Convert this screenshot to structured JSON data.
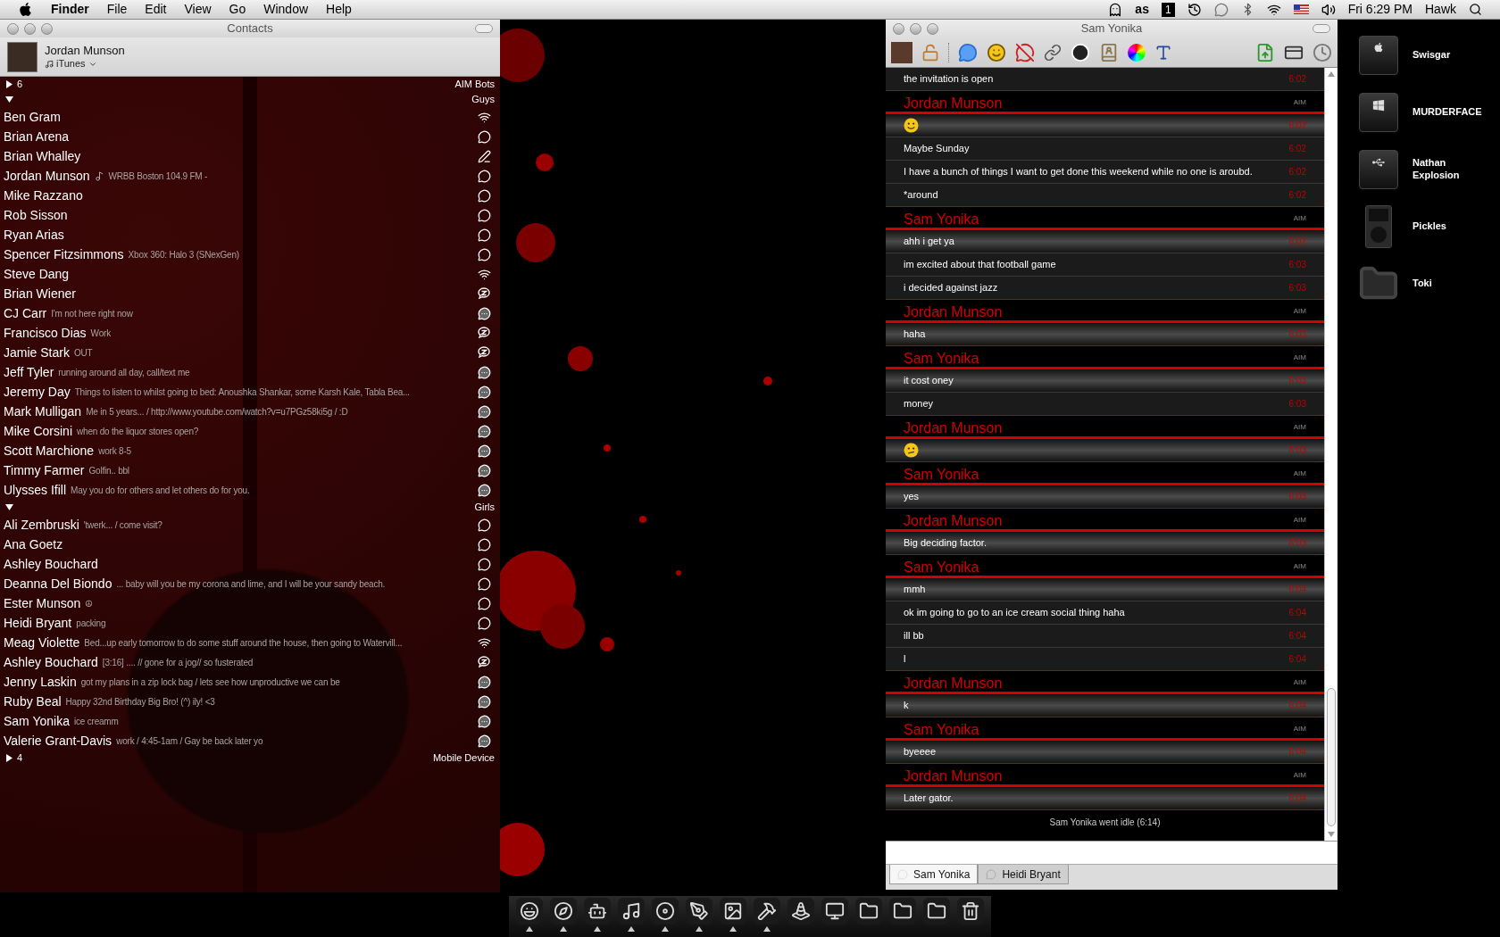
{
  "menu_bar": {
    "app": "Finder",
    "menus": [
      "File",
      "Edit",
      "View",
      "Go",
      "Window",
      "Help"
    ],
    "spaces_number": "1",
    "lastfm_label": "as",
    "clock": "Fri 6:29 PM",
    "user": "Hawk"
  },
  "contacts_window": {
    "title": "Contacts",
    "profile": {
      "name": "Jordan Munson",
      "status": "iTunes"
    },
    "groups": [
      {
        "name": "AIM Bots",
        "count": "6",
        "expanded": false
      },
      {
        "name": "Guys",
        "expanded": true,
        "contacts": [
          {
            "name": "Ben Gram",
            "kind": "mobile"
          },
          {
            "name": "Brian Arena",
            "kind": "available"
          },
          {
            "name": "Brian Whalley",
            "kind": "typing"
          },
          {
            "name": "Jordan Munson",
            "status": "WRBB Boston 104.9 FM -",
            "music": true,
            "kind": "available"
          },
          {
            "name": "Mike Razzano",
            "kind": "available"
          },
          {
            "name": "Rob Sisson",
            "kind": "available"
          },
          {
            "name": "Ryan Arias",
            "kind": "available"
          },
          {
            "name": "Spencer Fitzsimmons",
            "status": "Xbox 360: Halo 3 (SNexGen)",
            "kind": "available"
          },
          {
            "name": "Steve Dang",
            "kind": "mobile"
          },
          {
            "name": "Brian Wiener",
            "kind": "idle"
          },
          {
            "name": "CJ Carr",
            "status": "I'm not here right now",
            "kind": "away"
          },
          {
            "name": "Francisco Dias",
            "status": "Work",
            "kind": "idle"
          },
          {
            "name": "Jamie Stark",
            "status": "OUT",
            "kind": "idle"
          },
          {
            "name": "Jeff Tyler",
            "status": "running around all day, call/text me",
            "kind": "away"
          },
          {
            "name": "Jeremy Day",
            "status": "Things to listen to whilst going to bed: Anoushka Shankar, some Karsh Kale, Tabla Bea...",
            "kind": "away"
          },
          {
            "name": "Mark Mulligan",
            "status": "Me in 5 years... / http://www.youtube.com/watch?v=u7PGz58ki5g / :D",
            "kind": "away"
          },
          {
            "name": "Mike Corsini",
            "status": "when do the liquor stores open?",
            "kind": "away"
          },
          {
            "name": "Scott Marchione",
            "status": "work 8-5",
            "kind": "away"
          },
          {
            "name": "Timmy Farmer",
            "status": "Golfin.. bbl",
            "kind": "away"
          },
          {
            "name": "Ulysses Ifill",
            "status": "May you do for others and let others do for you.",
            "kind": "away"
          }
        ]
      },
      {
        "name": "Girls",
        "expanded": true,
        "contacts": [
          {
            "name": "Ali Zembruski",
            "status": "'twerk... / come visit?",
            "kind": "available"
          },
          {
            "name": "Ana Goetz",
            "kind": "available"
          },
          {
            "name": "Ashley Bouchard",
            "kind": "available"
          },
          {
            "name": "Deanna Del Biondo",
            "status": "... baby will you be my corona and lime, and I will be your sandy beach.",
            "kind": "available"
          },
          {
            "name": "Ester Munson",
            "status": "☮",
            "kind": "available"
          },
          {
            "name": "Heidi Bryant",
            "status": "packing",
            "kind": "available"
          },
          {
            "name": "Meag Violette",
            "status": "Bed...up early tomorrow to do some stuff around the house, then going to Watervill...",
            "kind": "mobile"
          },
          {
            "name": "Ashley Bouchard",
            "status": "[3:16] .... // gone for a jog// so fusterated",
            "kind": "idle"
          },
          {
            "name": "Jenny Laskin",
            "status": "got my plans in a zip lock bag / lets see how unproductive we can be",
            "kind": "away"
          },
          {
            "name": "Ruby Beal",
            "status": "Happy 32nd Birthday Big Bro! (^) ily! <3",
            "kind": "away"
          },
          {
            "name": "Sam Yonika",
            "status": "ice creamm",
            "kind": "away"
          },
          {
            "name": "Valerie Grant-Davis",
            "status": "work / 4:45-1am / Gay be back later yo",
            "kind": "away"
          }
        ]
      },
      {
        "name": "Mobile Device",
        "count": "4",
        "expanded": false
      }
    ]
  },
  "chat_window": {
    "title": "Sam Yonika",
    "blocks": [
      {
        "messages": [
          {
            "kind": "text",
            "text": "the invitation is open",
            "time": "6:02"
          }
        ]
      },
      {
        "sender": "Jordan Munson",
        "service": "AIM",
        "messages": [
          {
            "kind": "smile",
            "time": "6:02"
          },
          {
            "kind": "text",
            "text": "Maybe Sunday",
            "time": "6:02"
          },
          {
            "kind": "text",
            "text": "I have a bunch of things I want to get done this weekend while no one is aroubd.",
            "time": "6:02"
          },
          {
            "kind": "text",
            "text": "*around",
            "time": "6:02"
          }
        ]
      },
      {
        "sender": "Sam Yonika",
        "service": "AIM",
        "messages": [
          {
            "kind": "text",
            "text": "ahh i get ya",
            "time": "6:02"
          },
          {
            "kind": "text",
            "text": "im excited about that football game",
            "time": "6:03"
          },
          {
            "kind": "text",
            "text": "i decided against jazz",
            "time": "6:03"
          }
        ]
      },
      {
        "sender": "Jordan Munson",
        "service": "AIM",
        "messages": [
          {
            "kind": "text",
            "text": "haha",
            "time": "6:03"
          }
        ]
      },
      {
        "sender": "Sam Yonika",
        "service": "AIM",
        "messages": [
          {
            "kind": "text",
            "text": "it cost oney",
            "time": "6:03"
          },
          {
            "kind": "text",
            "text": "money",
            "time": "6:03"
          }
        ]
      },
      {
        "sender": "Jordan Munson",
        "service": "AIM",
        "messages": [
          {
            "kind": "confused",
            "time": "6:03"
          }
        ]
      },
      {
        "sender": "Sam Yonika",
        "service": "AIM",
        "messages": [
          {
            "kind": "text",
            "text": "yes",
            "time": "6:03"
          }
        ]
      },
      {
        "sender": "Jordan Munson",
        "service": "AIM",
        "messages": [
          {
            "kind": "text",
            "text": "Big deciding factor.",
            "time": "6:03"
          }
        ]
      },
      {
        "sender": "Sam Yonika",
        "service": "AIM",
        "messages": [
          {
            "kind": "text",
            "text": "mmh",
            "time": "6:04"
          },
          {
            "kind": "text",
            "text": "ok im going to go to an ice cream social thing haha",
            "time": "6:04"
          },
          {
            "kind": "text",
            "text": "ill bb",
            "time": "6:04"
          },
          {
            "kind": "text",
            "text": "l",
            "time": "6:04"
          }
        ]
      },
      {
        "sender": "Jordan Munson",
        "service": "AIM",
        "messages": [
          {
            "kind": "text",
            "text": "k",
            "time": "6:04"
          }
        ]
      },
      {
        "sender": "Sam Yonika",
        "service": "AIM",
        "messages": [
          {
            "kind": "text",
            "text": "byeeee",
            "time": "6:04"
          }
        ]
      },
      {
        "sender": "Jordan Munson",
        "service": "AIM",
        "messages": [
          {
            "kind": "text",
            "text": "Later gator.",
            "time": "6:04"
          }
        ]
      }
    ],
    "notice": "Sam Yonika went idle (6:14)",
    "tabs": [
      {
        "label": "Sam Yonika",
        "selected": true
      },
      {
        "label": "Heidi Bryant",
        "selected": false
      }
    ]
  },
  "desktop_icons": [
    {
      "label": "Swisgar",
      "kind": "apple-drive"
    },
    {
      "label": "MURDERFACE",
      "kind": "windows-drive"
    },
    {
      "label": "Nathan Explosion",
      "kind": "usb-drive"
    },
    {
      "label": "Pickles",
      "kind": "ipod"
    },
    {
      "label": "Toki",
      "kind": "folder"
    }
  ],
  "dock": [
    {
      "running": true
    },
    {
      "running": true
    },
    {
      "running": true
    },
    {
      "running": true
    },
    {
      "running": true
    },
    {
      "running": true
    },
    {
      "running": true
    },
    {
      "running": true
    },
    {
      "running": false
    },
    {
      "running": false
    },
    {
      "running": false
    },
    {
      "running": false
    },
    {
      "running": false
    },
    {
      "running": false
    }
  ]
}
